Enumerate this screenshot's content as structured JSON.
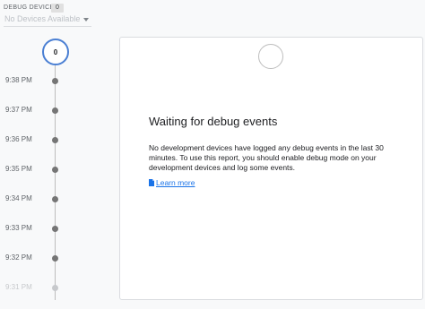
{
  "header": {
    "debug_device_label": "DEBUG DEVICE",
    "device_count": "0",
    "device_select": {
      "value": "No Devices Available"
    }
  },
  "timeline": {
    "current_count": "0",
    "ticks": [
      "9:38 PM",
      "9:37 PM",
      "9:36 PM",
      "9:35 PM",
      "9:34 PM",
      "9:33 PM",
      "9:32 PM",
      "9:31 PM"
    ]
  },
  "card": {
    "title": "Waiting for debug events",
    "text": "No development devices have logged any debug events in the last 30 minutes. To use this report, you should enable debug mode on your development devices and log some events.",
    "link": "Learn more"
  },
  "colors": {
    "accent": "#4a7fd3",
    "link": "#1a73e8",
    "dot": "#757575"
  }
}
